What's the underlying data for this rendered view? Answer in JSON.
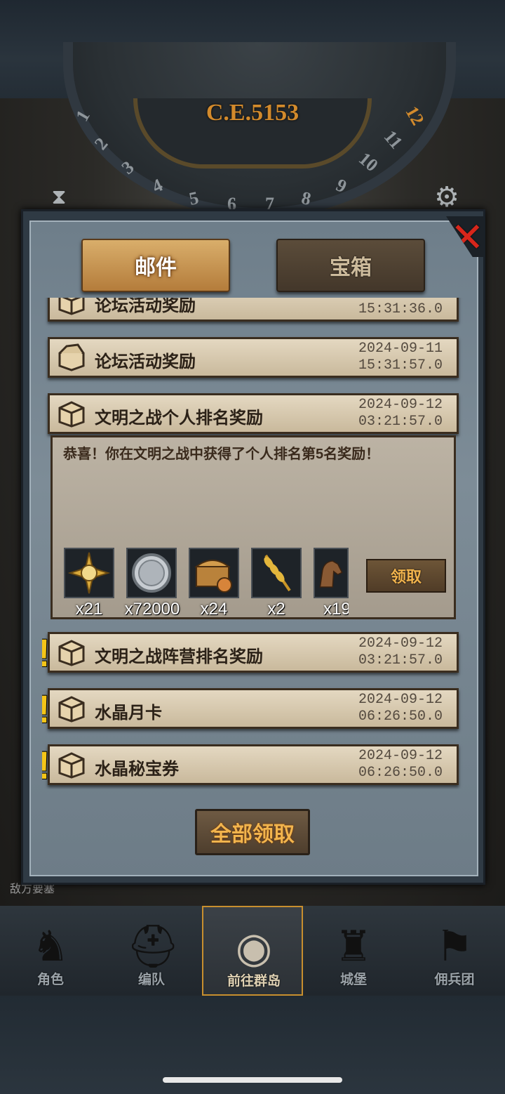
{
  "header": {
    "era": "C.E.5153",
    "dial_numbers": [
      "1",
      "2",
      "3",
      "4",
      "5",
      "6",
      "7",
      "8",
      "9",
      "10",
      "11",
      "12"
    ]
  },
  "tabs": {
    "mail": "邮件",
    "chest": "宝箱"
  },
  "mails": [
    {
      "title": "论坛活动奖励",
      "date": "",
      "time": "15:31:36.0",
      "alert": false
    },
    {
      "title": "论坛活动奖励",
      "date": "2024-09-11",
      "time": "15:31:57.0",
      "alert": false
    },
    {
      "title": "文明之战个人排名奖励",
      "date": "2024-09-12",
      "time": "03:21:57.0",
      "alert": false
    },
    {
      "title": "文明之战阵营排名奖励",
      "date": "2024-09-12",
      "time": "03:21:57.0",
      "alert": true
    },
    {
      "title": "水晶月卡",
      "date": "2024-09-12",
      "time": "06:26:50.0",
      "alert": true
    },
    {
      "title": "水晶秘宝券",
      "date": "2024-09-12",
      "time": "06:26:50.0",
      "alert": true
    }
  ],
  "expanded": {
    "body": "恭喜！你在文明之战中获得了个人排名第5名奖励！",
    "rewards": [
      {
        "icon": "compass-medal-icon",
        "count": "x21"
      },
      {
        "icon": "silver-coin-icon",
        "count": "x72000"
      },
      {
        "icon": "treasure-chest-icon",
        "count": "x24"
      },
      {
        "icon": "wheat-icon",
        "count": "x2"
      },
      {
        "icon": "horse-icon",
        "count": "x19"
      }
    ],
    "claim_label": "领取"
  },
  "claim_all_label": "全部领取",
  "nav": [
    {
      "label": "角色",
      "icon": "knight-icon"
    },
    {
      "label": "编队",
      "icon": "helmet-icon"
    },
    {
      "label": "前往群岛",
      "icon": "globe-icon"
    },
    {
      "label": "城堡",
      "icon": "castle-icon"
    },
    {
      "label": "佣兵团",
      "icon": "banner-icon"
    }
  ],
  "side_label": "敌方要塞"
}
